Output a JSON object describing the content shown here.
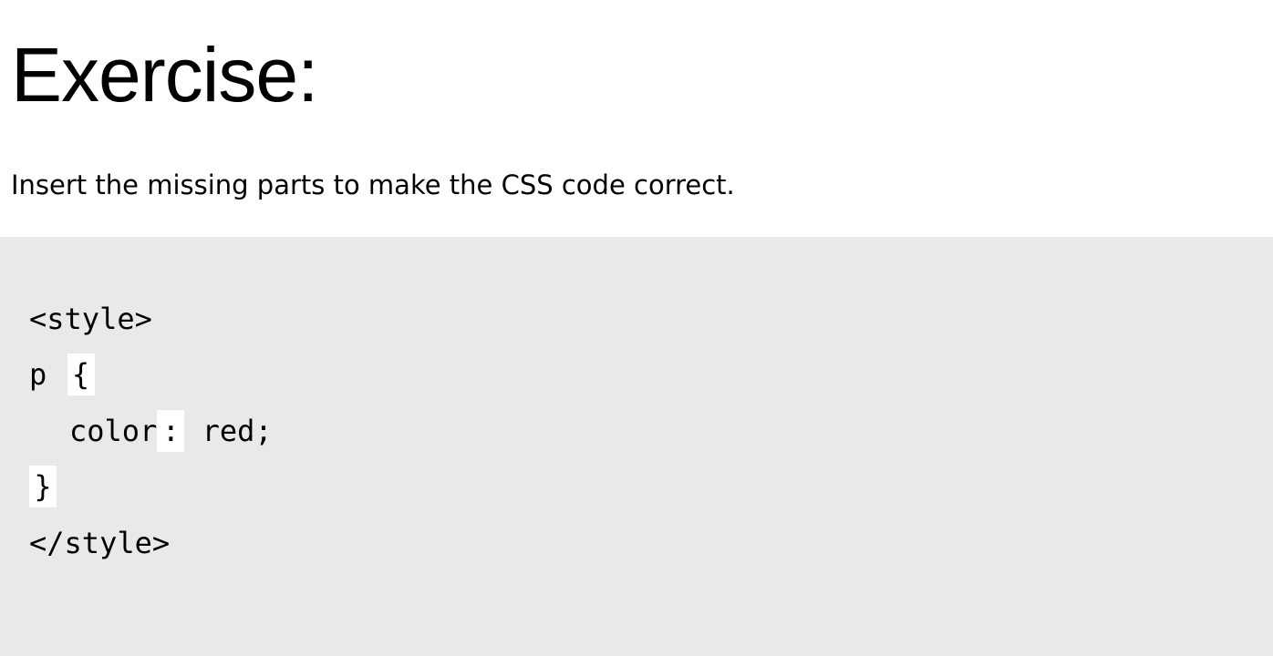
{
  "heading": "Exercise:",
  "instructions": "Insert the missing parts to make the CSS code correct.",
  "code": {
    "line1": "<style>",
    "line2_selector": "p ",
    "line2_blank": "{",
    "line3_property": "color",
    "line3_blank": ":",
    "line3_value": " red;",
    "line4_blank": "}",
    "line5": "</style>"
  },
  "colors": {
    "code_background": "#e7e9eb",
    "blank_background": "#ffffff"
  }
}
